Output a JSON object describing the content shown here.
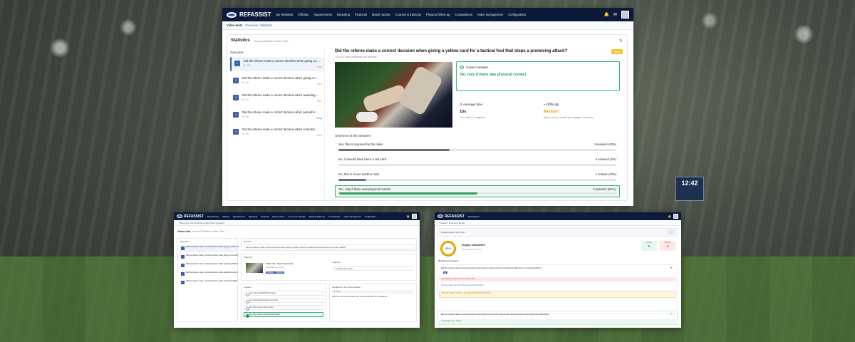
{
  "background": {
    "scoreboard": "12:42"
  },
  "main_window": {
    "brand": "REFASSIST",
    "nav_items": [
      "My Refassist",
      "Officials",
      "Appointments",
      "Reporting",
      "Financial",
      "Match reports",
      "Courses & trainings",
      "Physical follow-up",
      "Competitions",
      "Video management",
      "Configuration"
    ],
    "breadcrumb": {
      "root": "Video tests",
      "path": "Overview / Statistics"
    },
    "panel_title": "Statistics",
    "panel_subtitle": "Annual Referee Video Test",
    "overview_label": "Overview",
    "questions": [
      {
        "num": "1",
        "text": "Did the referee make a correct decision when giving a yellow card for a tactical foul that stops a promising attack?",
        "meta": "8 / 10",
        "difficulty": "Med"
      },
      {
        "num": "2",
        "text": "Did the referee make a correct decision when giving a red card?",
        "meta": "6 / 10",
        "difficulty": "Med"
      },
      {
        "num": "3",
        "text": "Did the referee make a correct decision when awarding offside?",
        "meta": "5 / 10",
        "difficulty": "Med"
      },
      {
        "num": "4",
        "text": "Did the referee make a correct decision when penalizing a foul?",
        "meta": "8 / 10",
        "difficulty": "Easy"
      },
      {
        "num": "5",
        "text": "Did the referee make a correct decision when consulting VAR?",
        "meta": "4 / 10",
        "difficulty": "Med"
      }
    ],
    "detail": {
      "question": "Did the referee make a correct decision when giving a yellow card for a tactical foul that stops a promising attack?",
      "note": "10 of 10 have answered this question",
      "badge": "Med",
      "correct_answer_label": "Correct answer",
      "correct_answer": "No, only if there was physical contact",
      "avg_time_label": "Average time",
      "avg_time_value": "15s",
      "avg_time_note": "Time taken to respond",
      "difficulty_label": "Difficulty",
      "difficulty_value": "Medium",
      "difficulty_note": "Based on the overall percentage of answers",
      "answers_title": "Overview of the answers",
      "answers": [
        {
          "label": "Yes, this is required by the rules",
          "count": "4 answers (40%)",
          "pct": 0.4,
          "correct": false
        },
        {
          "label": "No, it should have been a red card",
          "count": "0 answers (0%)",
          "pct": 0.0,
          "correct": false
        },
        {
          "label": "No, this is never worth a card",
          "count": "1 answer (10%)",
          "pct": 0.1,
          "correct": false
        },
        {
          "label": "No, only if there was physical contact",
          "count": "5 answers (50%)",
          "pct": 0.5,
          "correct": true
        }
      ]
    }
  },
  "editor_window": {
    "brand": "REFASSIST",
    "nav_items": [
      "My Refassist",
      "Officials",
      "Appointments",
      "Reporting",
      "Financial",
      "Match reports",
      "Courses & trainings",
      "Physical follow-up",
      "Competitions",
      "Video management",
      "Configuration"
    ],
    "breadcrumb": "Video tests / Annual Referee Video Test / Questions",
    "title": "Video test",
    "title_sub": "Annual Referee Video Test",
    "sidebar_title": "Questions",
    "questions_label": "Question",
    "question_value": "Did the referee make a correct decision when giving a yellow card for a tactical foul that stops a promising attack?",
    "video_label": "Video clip",
    "video_title": "Video clip - Tactical foul.mp4",
    "video_meta": "Uploaded on 12 Feb",
    "video_btn1": "Replace",
    "video_btn2": "Remove",
    "help_label": "Help text",
    "help_value": "Consider the contact",
    "answers_label": "Answers",
    "answers": [
      "Yes, this is required by the rules",
      "No, it should have been a red card",
      "No, this is never worth a card",
      "No, only if there was physical contact"
    ],
    "feedback_label": "Feedback on the correct answer",
    "feedback_text": "With the referee's decision, the referee followed the guidelines."
  },
  "result_window": {
    "brand": "REFASSIST",
    "nav_item": "My Refassist",
    "breadcrumb": "Inquiries / Overview / Result",
    "title": "Annual Referee Video Test",
    "ring_value": "60%",
    "completed_label": "Inquiry completed",
    "completed_sub": "You answered 6 of 10",
    "correct_label": "Correct",
    "correct_n": "6",
    "wrong_label": "Incorrect",
    "wrong_n": "4",
    "answers_header": "Review your answers",
    "q1": "Did the referee make a correct decision when giving a yellow card for a tactical foul that stops a promising attack?",
    "q1_wrong": "Your answer: No, this is never worth a card",
    "q1_right": "Correct answer: No, only if there was physical contact",
    "q1_feedback": "With the referee's decision, the referee followed the guidelines.",
    "q2": "Did the referee make a correct decision when giving a red card for denying an obvious goal-scoring opportunity (DOGSO)?",
    "q2_right": "Your answer: Yes, always"
  }
}
